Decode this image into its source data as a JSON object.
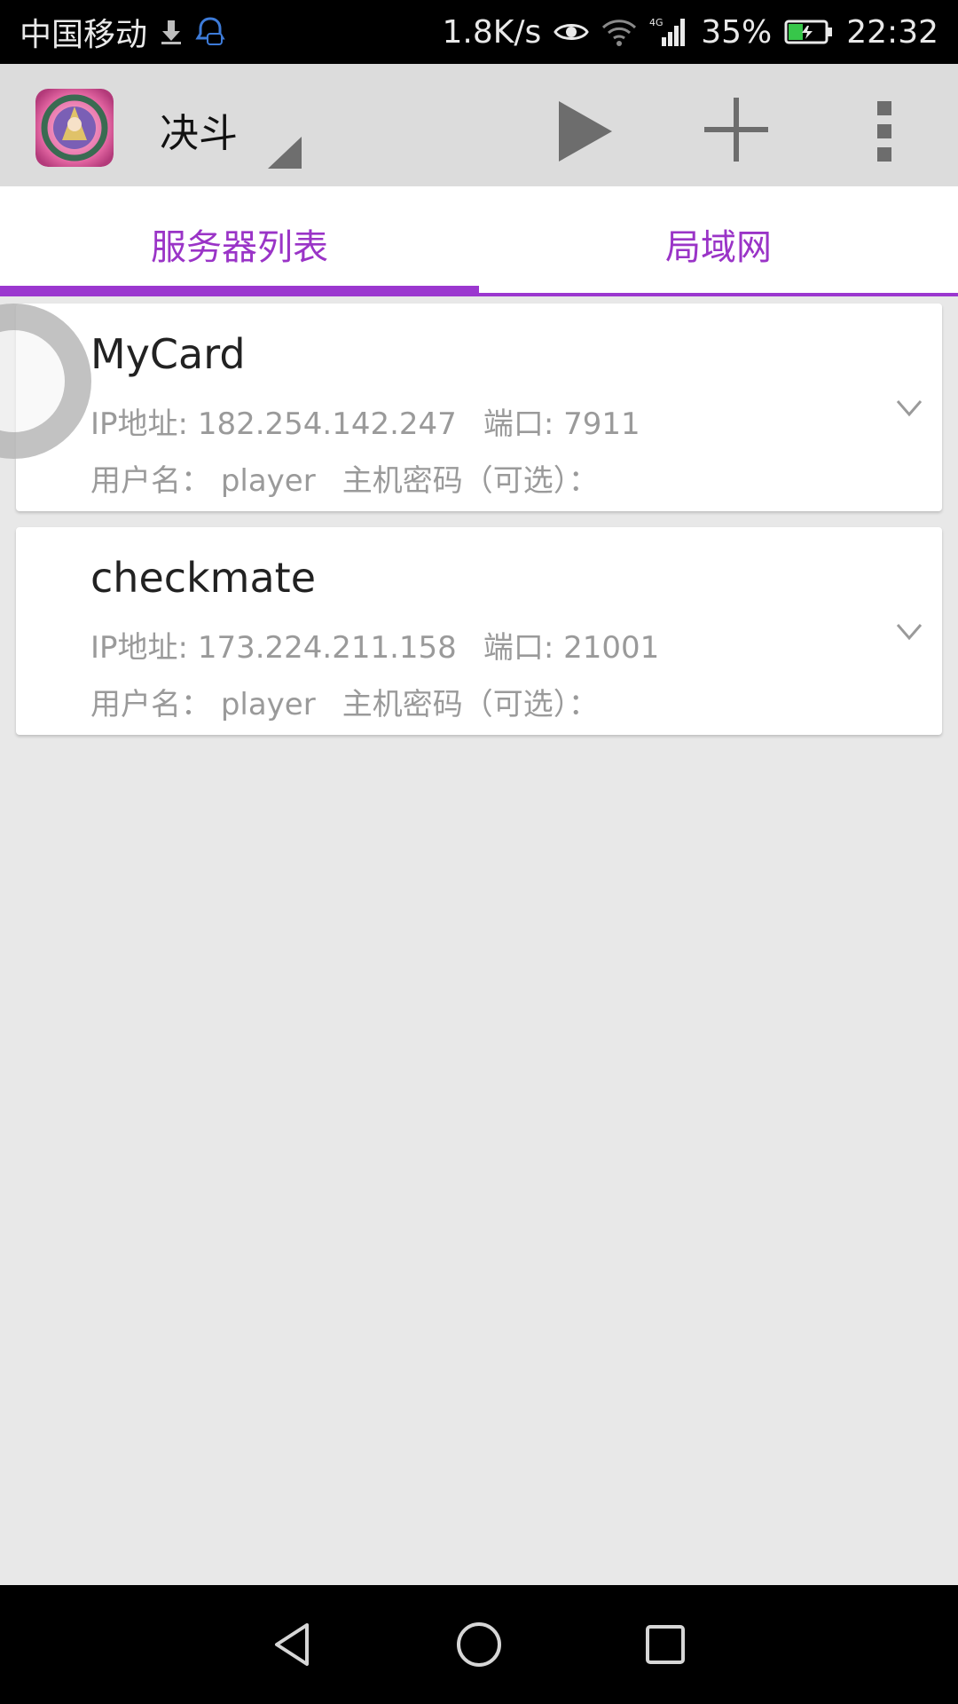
{
  "status_bar": {
    "carrier": "中国移动",
    "speed": "1.8K/s",
    "network": "4G",
    "battery": "35%",
    "time": "22:32"
  },
  "toolbar": {
    "spinner_value": "决斗"
  },
  "tabs": [
    {
      "label": "服务器列表",
      "selected": true
    },
    {
      "label": "局域网",
      "selected": false
    }
  ],
  "servers": [
    {
      "name": "MyCard",
      "ip_label": "IP地址:",
      "ip": "182.254.142.247",
      "port_label": "端口:",
      "port": "7911",
      "user_label": "用户名：",
      "user": "player",
      "password_label": "主机密码（可选）："
    },
    {
      "name": "checkmate",
      "ip_label": "IP地址:",
      "ip": "173.224.211.158",
      "port_label": "端口:",
      "port": "21001",
      "user_label": "用户名：",
      "user": "player",
      "password_label": "主机密码（可选）："
    }
  ],
  "colors": {
    "accent": "#9b37cf",
    "toolbar": "#dcdcdc",
    "background": "#e8e8e8"
  }
}
